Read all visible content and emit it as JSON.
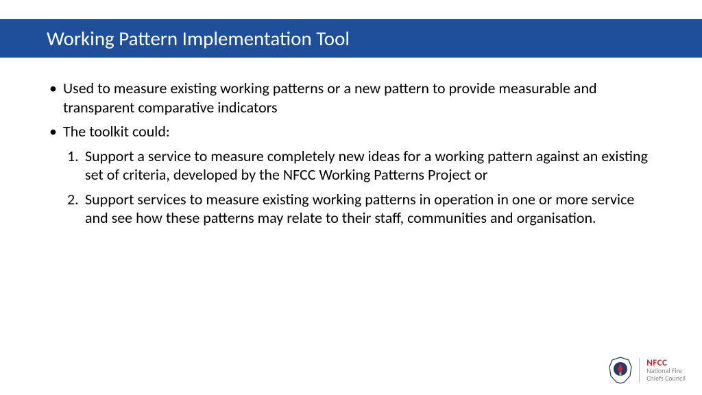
{
  "slide": {
    "title": "Working Pattern Implementation Tool",
    "bullets": [
      "Used to measure existing working patterns or a new pattern to provide measurable and transparent comparative indicators",
      "The toolkit could:"
    ],
    "numbered": [
      "Support a service to measure completely new ideas for a working pattern against an existing set of criteria, developed by the NFCC Working Patterns Project or",
      "Support services to measure existing working patterns in operation in one or more service and see how these patterns may relate to their staff, communities and organisation."
    ]
  },
  "logo": {
    "acronym": "NFCC",
    "line1": "National Fire",
    "line2": "Chiefs Council"
  }
}
